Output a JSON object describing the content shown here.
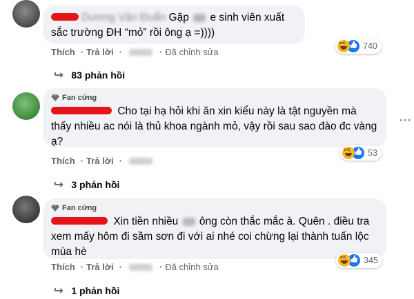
{
  "actions": {
    "like": "Thích",
    "reply": "Trả lời",
    "edited": "Đã chỉnh sửa"
  },
  "badge_label": "Fan cứng",
  "comments": [
    {
      "text_part1": "Gặp",
      "text_part2": "e sinh viên xuất sắc trường ĐH “mỏ” rồi ông ạ =))))",
      "reaction_count": "740",
      "replies": "83 phản hồi"
    },
    {
      "text": "Cho tại hạ hỏi khi ăn xin kiểu này là tật nguyền mà thấy nhiều ac nói là thủ khoa ngành mỏ, vậy rồi sau sao đào đc vàng ạ?",
      "reaction_count": "53",
      "replies": "3 phản hồi"
    },
    {
      "text_part1": "Xin tiền nhiều",
      "text_part2": "ông còn thắc mắc à. Quên . điều tra xem mấy hôm đi sầm sơn đi với ai nhé coi chừng lại thành tuấn lộc mùa hè",
      "reaction_count": "345",
      "replies": "1 phản hồi"
    }
  ],
  "more_icon": "more-horizontal-icon",
  "colors": {
    "bubble": "#f0f2f5",
    "redaction": "#e8141b",
    "muted": "#65676b",
    "like_blue": "#1877f2",
    "haha_yellow": "#f7b928"
  }
}
